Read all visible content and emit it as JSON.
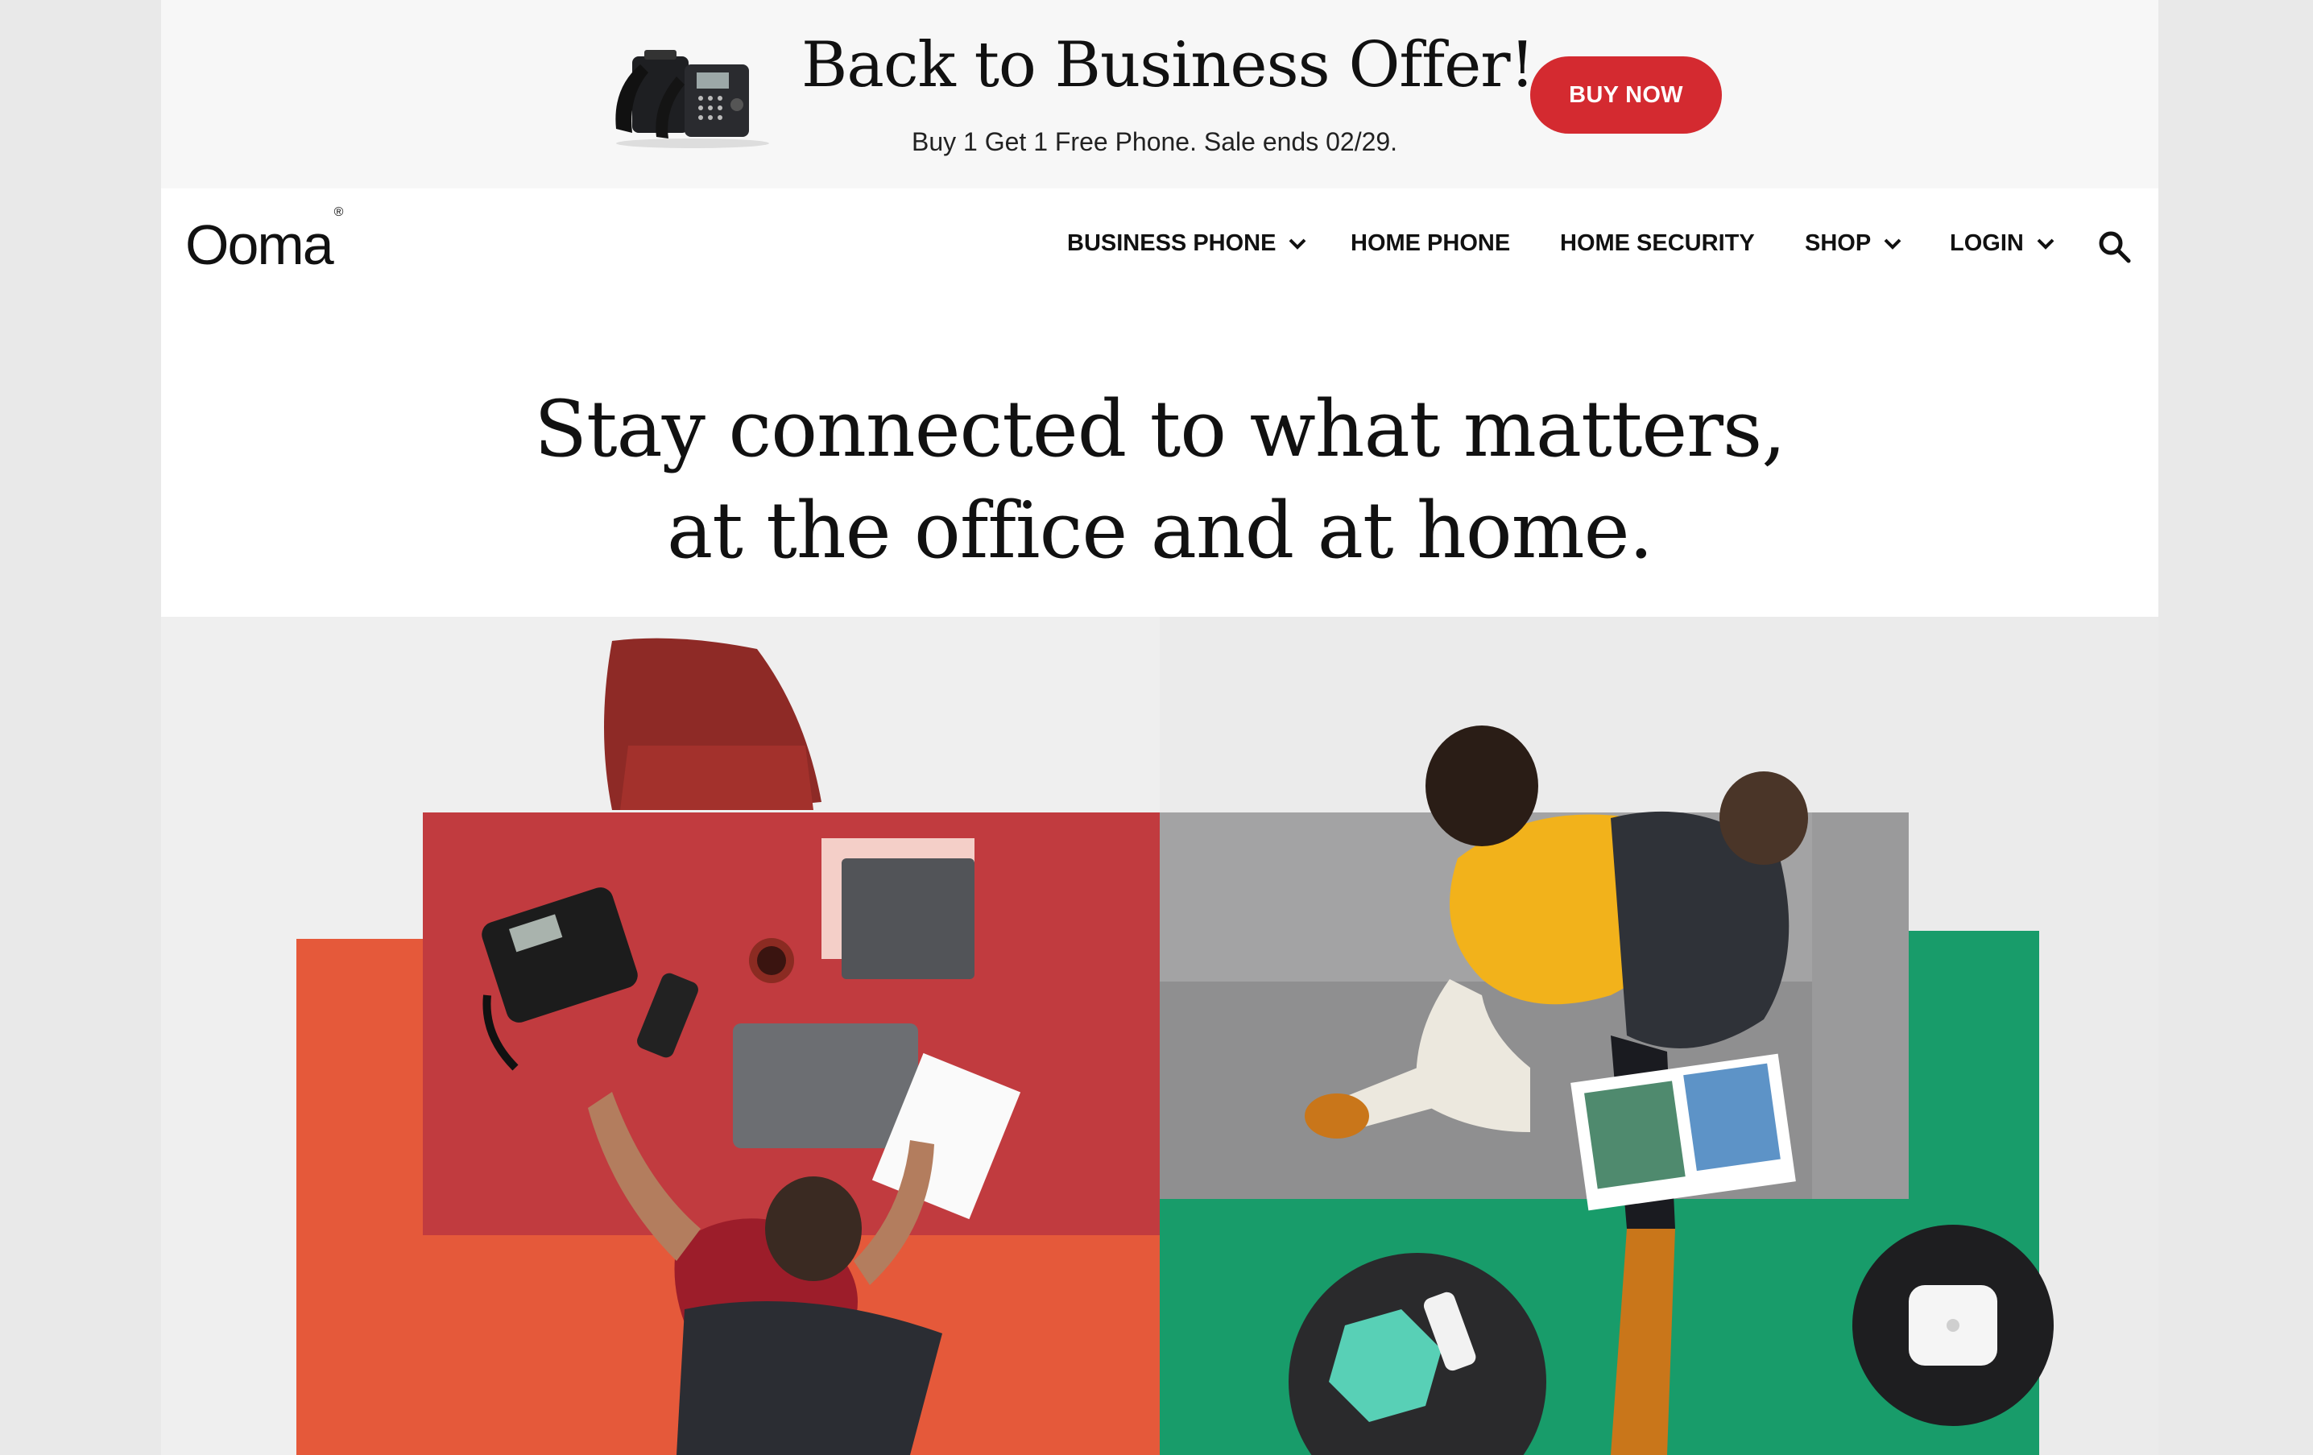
{
  "promo": {
    "title": "Back to Business Offer!",
    "subtitle": "Buy 1 Get 1 Free Phone. Sale ends 02/29.",
    "cta_label": "BUY NOW",
    "cta_color": "#d42a30"
  },
  "header": {
    "logo_text": "Ooma",
    "logo_mark": "®"
  },
  "nav": {
    "items": [
      {
        "label": "BUSINESS PHONE",
        "has_dropdown": true
      },
      {
        "label": "HOME PHONE",
        "has_dropdown": false
      },
      {
        "label": "HOME SECURITY",
        "has_dropdown": false
      },
      {
        "label": "SHOP",
        "has_dropdown": true
      },
      {
        "label": "LOGIN",
        "has_dropdown": true
      }
    ],
    "search_icon": "search-icon"
  },
  "hero": {
    "line1": "Stay connected to what matters,",
    "line2": "at the office and at home."
  }
}
